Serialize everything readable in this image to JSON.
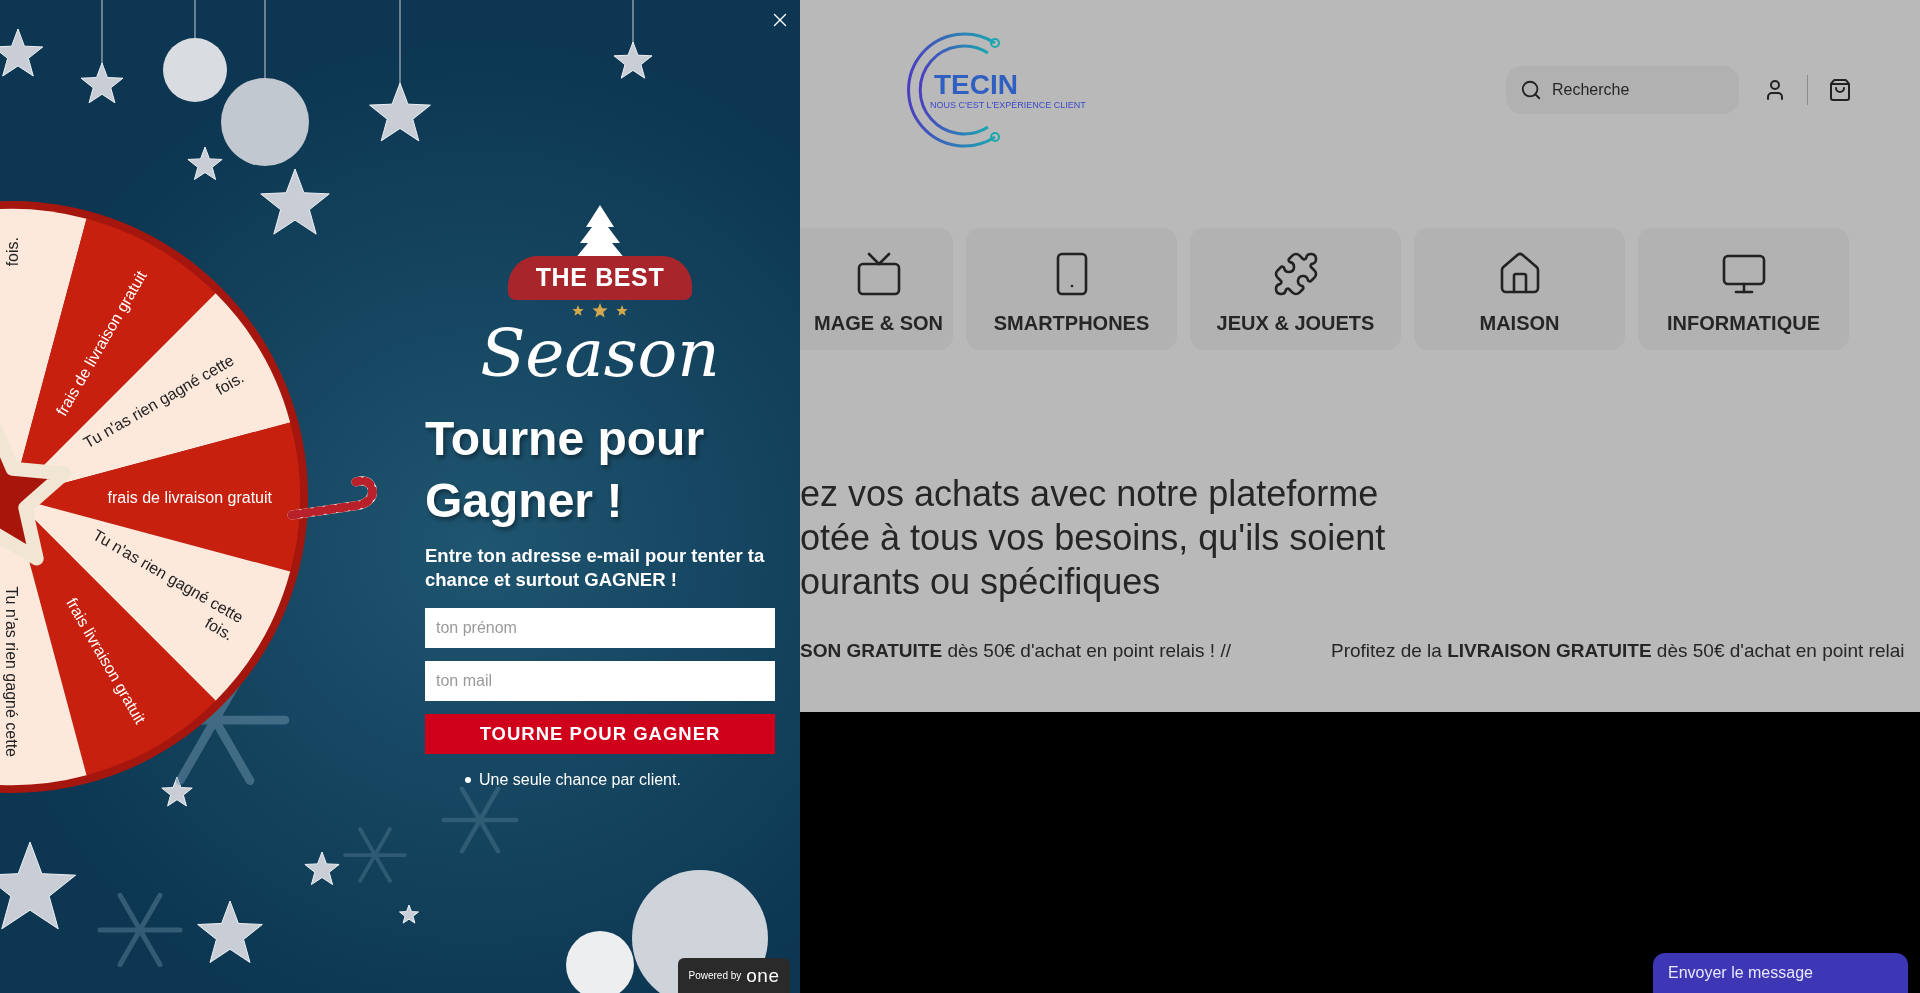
{
  "popup": {
    "logo": {
      "ribbon": "THE BEST",
      "script": "Season"
    },
    "title": "Tourne pour Gagner !",
    "subtitle": "Entre ton adresse e-mail pour tenter ta chance et surtout GAGNER !",
    "fields": [
      {
        "placeholder": "ton prénom"
      },
      {
        "placeholder": "ton mail"
      }
    ],
    "button": "TOURNE POUR GAGNER",
    "notes": [
      "Une seule chance par client."
    ],
    "powered_by": {
      "label": "Powered by",
      "brand": "one"
    }
  },
  "wheel": {
    "segments": [
      {
        "kind": "lose",
        "lines": [
          "fois."
        ]
      },
      {
        "kind": "prize",
        "lines": [
          "frais de livraison gratuit"
        ]
      },
      {
        "kind": "lose",
        "lines": [
          "Tu n'as rien gagné cette",
          "fois."
        ]
      },
      {
        "kind": "prize",
        "lines": [
          "frais de livraison gratuit"
        ]
      },
      {
        "kind": "lose",
        "lines": [
          "Tu n'as rien gagné cette",
          "fois."
        ]
      },
      {
        "kind": "prize",
        "lines": [
          "frais livraison gratuit"
        ]
      },
      {
        "kind": "lose",
        "lines": [
          "Tu n'as rien gagné cette"
        ]
      }
    ]
  },
  "header": {
    "logo": {
      "name": "TECIN",
      "tagline": "NOUS C'EST L'EXPÉRIENCE CLIENT"
    },
    "search": {
      "placeholder": "Recherche"
    }
  },
  "categories": [
    {
      "kind": "tv",
      "label": "MAGE & SON"
    },
    {
      "kind": "phone",
      "label": "SMARTPHONES"
    },
    {
      "kind": "puzzle",
      "label": "JEUX & JOUETS"
    },
    {
      "kind": "house",
      "label": "MAISON"
    },
    {
      "kind": "computer",
      "label": "INFORMATIQUE"
    }
  ],
  "hero": {
    "lines": [
      "ez vos achats avec notre plateforme",
      "otée à tous vos besoins, qu'ils soient",
      "ourants ou spécifiques"
    ]
  },
  "marquee": [
    "**SON GRATUITE** dès 50€ d'achat en point relais ! //",
    "Profitez de la **LIVRAISON GRATUITE** dès 50€ d'achat en point relai"
  ],
  "chat": {
    "label": "Envoyer le message"
  }
}
